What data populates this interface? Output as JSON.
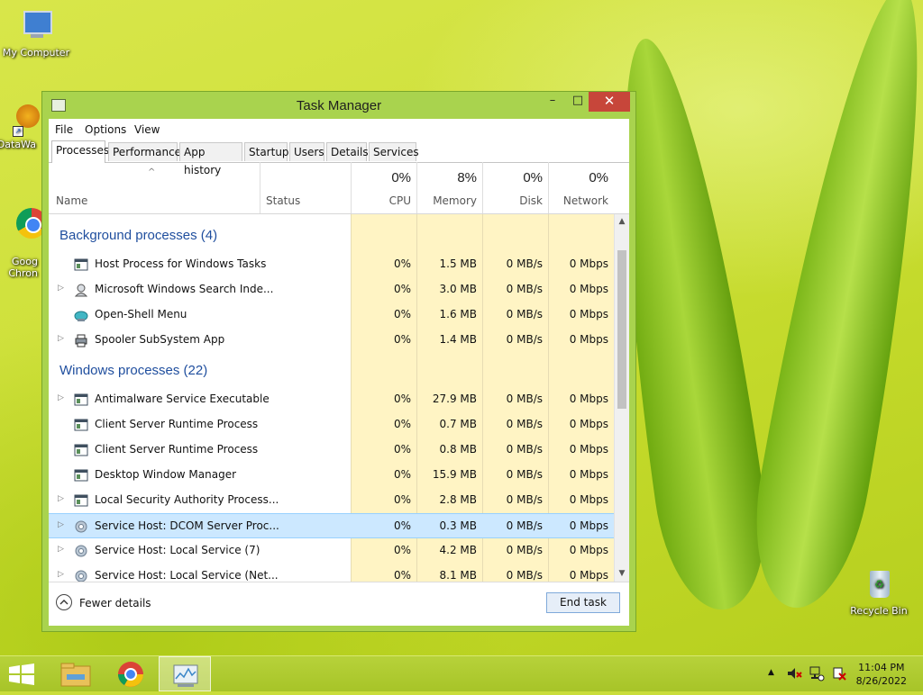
{
  "desktop": {
    "icons": [
      {
        "label": "My Computer"
      },
      {
        "label": "DataWa"
      },
      {
        "label": "Goog\nChron"
      },
      {
        "label": "Recycle Bin"
      }
    ]
  },
  "window": {
    "title": "Task Manager",
    "controls": {
      "minimize": "–",
      "maximize": "□",
      "close": "✕"
    },
    "menu": [
      "File",
      "Options",
      "View"
    ],
    "tabs": [
      "Processes",
      "Performance",
      "App history",
      "Startup",
      "Users",
      "Details",
      "Services"
    ],
    "active_tab": "Processes",
    "columns": {
      "name": "Name",
      "status": "Status",
      "cpu": {
        "pct": "0%",
        "label": "CPU"
      },
      "memory": {
        "pct": "8%",
        "label": "Memory"
      },
      "disk": {
        "pct": "0%",
        "label": "Disk"
      },
      "network": {
        "pct": "0%",
        "label": "Network"
      }
    },
    "groups": [
      {
        "title": "Background processes (4)",
        "rows": [
          {
            "name": "Host Process for Windows Tasks",
            "cpu": "0%",
            "memory": "1.5 MB",
            "disk": "0 MB/s",
            "network": "0 Mbps",
            "expandable": false,
            "icon": "window-app-icon"
          },
          {
            "name": "Microsoft Windows Search Inde...",
            "cpu": "0%",
            "memory": "3.0 MB",
            "disk": "0 MB/s",
            "network": "0 Mbps",
            "expandable": true,
            "icon": "search-person-icon"
          },
          {
            "name": "Open-Shell Menu",
            "cpu": "0%",
            "memory": "1.6 MB",
            "disk": "0 MB/s",
            "network": "0 Mbps",
            "expandable": false,
            "icon": "shell-icon"
          },
          {
            "name": "Spooler SubSystem App",
            "cpu": "0%",
            "memory": "1.4 MB",
            "disk": "0 MB/s",
            "network": "0 Mbps",
            "expandable": true,
            "icon": "printer-icon"
          }
        ]
      },
      {
        "title": "Windows processes (22)",
        "rows": [
          {
            "name": "Antimalware Service Executable",
            "cpu": "0%",
            "memory": "27.9 MB",
            "disk": "0 MB/s",
            "network": "0 Mbps",
            "expandable": true,
            "icon": "window-app-icon"
          },
          {
            "name": "Client Server Runtime Process",
            "cpu": "0%",
            "memory": "0.7 MB",
            "disk": "0 MB/s",
            "network": "0 Mbps",
            "expandable": false,
            "icon": "window-app-icon"
          },
          {
            "name": "Client Server Runtime Process",
            "cpu": "0%",
            "memory": "0.8 MB",
            "disk": "0 MB/s",
            "network": "0 Mbps",
            "expandable": false,
            "icon": "window-app-icon"
          },
          {
            "name": "Desktop Window Manager",
            "cpu": "0%",
            "memory": "15.9 MB",
            "disk": "0 MB/s",
            "network": "0 Mbps",
            "expandable": false,
            "icon": "window-app-icon"
          },
          {
            "name": "Local Security Authority Process...",
            "cpu": "0%",
            "memory": "2.8 MB",
            "disk": "0 MB/s",
            "network": "0 Mbps",
            "expandable": true,
            "icon": "window-app-icon"
          },
          {
            "name": "Service Host: DCOM Server Proc...",
            "cpu": "0%",
            "memory": "0.3 MB",
            "disk": "0 MB/s",
            "network": "0 Mbps",
            "expandable": true,
            "icon": "gear-icon",
            "selected": true
          },
          {
            "name": "Service Host: Local Service (7)",
            "cpu": "0%",
            "memory": "4.2 MB",
            "disk": "0 MB/s",
            "network": "0 Mbps",
            "expandable": true,
            "icon": "gear-icon"
          },
          {
            "name": "Service Host: Local Service (Net...",
            "cpu": "0%",
            "memory": "8.1 MB",
            "disk": "0 MB/s",
            "network": "0 Mbps",
            "expandable": true,
            "icon": "gear-icon"
          }
        ]
      }
    ],
    "footer": {
      "fewer_details": "Fewer details",
      "end_task": "End task"
    }
  },
  "taskbar": {
    "clock_time": "11:04 PM",
    "clock_date": "8/26/2022"
  },
  "colors": {
    "heat": "#fff4c4",
    "group_title": "#1f4e9e",
    "selection": "#cce8ff",
    "close_button": "#c7463a"
  }
}
